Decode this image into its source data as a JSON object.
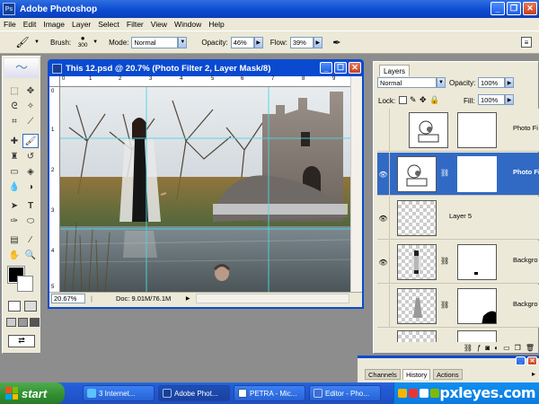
{
  "app": {
    "title": "Adobe Photoshop",
    "logo_text": "Ps"
  },
  "menu": [
    "File",
    "Edit",
    "Image",
    "Layer",
    "Select",
    "Filter",
    "View",
    "Window",
    "Help"
  ],
  "options_bar": {
    "brush_label": "Brush:",
    "brush_size": "300",
    "mode_label": "Mode:",
    "mode_value": "Normal",
    "opacity_label": "Opacity:",
    "opacity_value": "46%",
    "flow_label": "Flow:",
    "flow_value": "39%"
  },
  "document": {
    "title": "This 12.psd @ 20.7% (Photo Filter 2, Layer Mask/8)",
    "zoom": "20.67%",
    "doc_info": "Doc: 9.01M/76.1M",
    "ruler_top": [
      "0",
      "1",
      "2",
      "3",
      "4",
      "5",
      "6",
      "7",
      "8",
      "9"
    ],
    "ruler_left": [
      "0",
      "1",
      "2",
      "3",
      "4",
      "5"
    ]
  },
  "layers_panel": {
    "tab": "Layers",
    "blend_mode": "Normal",
    "opacity_label": "Opacity:",
    "opacity_value": "100%",
    "lock_label": "Lock:",
    "fill_label": "Fill:",
    "fill_value": "100%",
    "layers": [
      {
        "name": "Photo Fi",
        "visible": false,
        "selected": false
      },
      {
        "name": "Photo Fi",
        "visible": true,
        "selected": true
      },
      {
        "name": "Layer 5",
        "visible": false,
        "selected": false
      },
      {
        "name": "Backgro",
        "visible": true,
        "selected": false
      },
      {
        "name": "Backgro",
        "visible": false,
        "selected": false
      }
    ]
  },
  "lower_panel": {
    "tabs": [
      "Channels",
      "History",
      "Actions"
    ],
    "active_tab": "History"
  },
  "taskbar": {
    "start_label": "start",
    "tasks": [
      "3 Internet...",
      "Adobe Phot...",
      "PETRA - Mic...",
      "Editor - Pho..."
    ],
    "active_task_index": 1
  },
  "watermark": "pxleyes.com",
  "colors": {
    "xp_blue": "#0a4ad0",
    "selection_blue": "#316ac5",
    "panel_bg": "#ece9d8",
    "guide_cyan": "#4dd6e0"
  }
}
